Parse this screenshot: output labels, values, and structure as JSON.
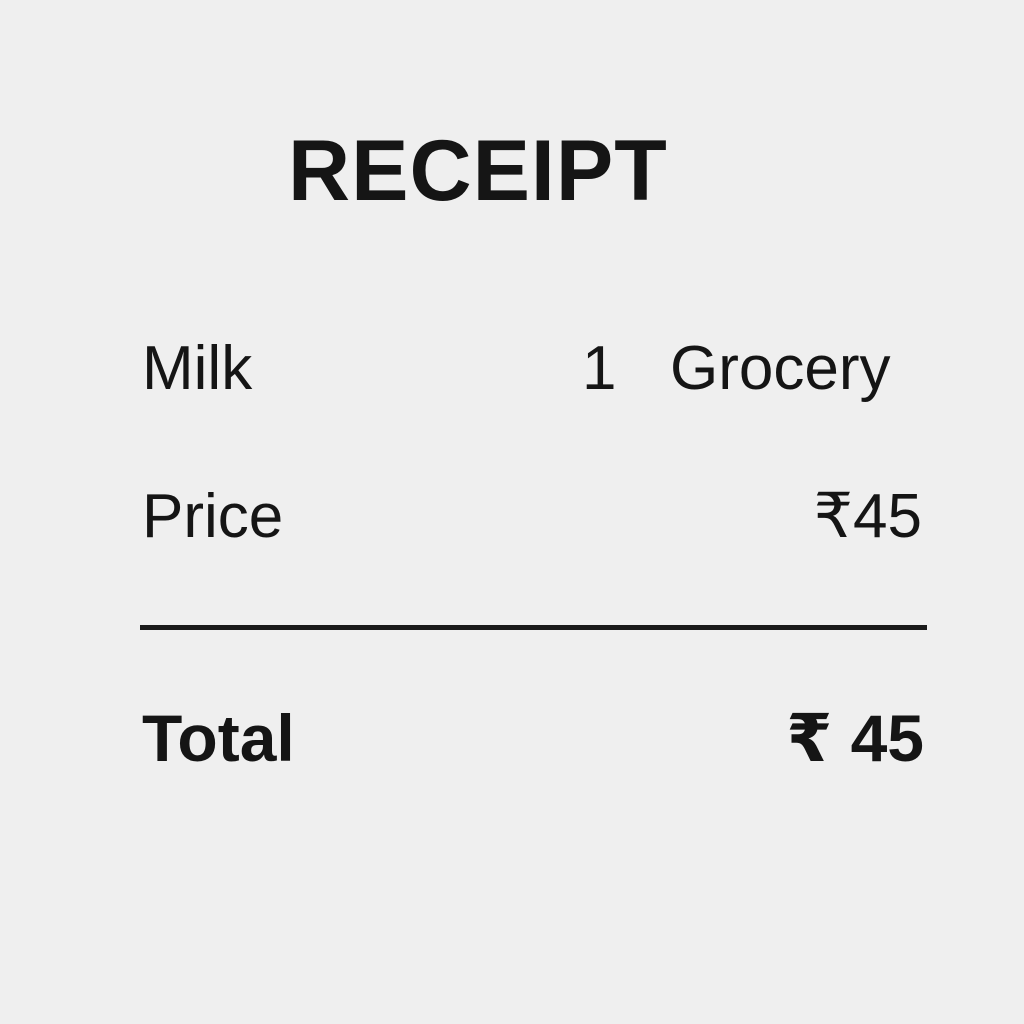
{
  "receipt": {
    "title": "RECEIPT",
    "item": {
      "name": "Milk",
      "quantity": "1",
      "category": "Grocery"
    },
    "price": {
      "label": "Price",
      "value": "₹45"
    },
    "total": {
      "label": "Total",
      "value": "₹ 45"
    }
  }
}
